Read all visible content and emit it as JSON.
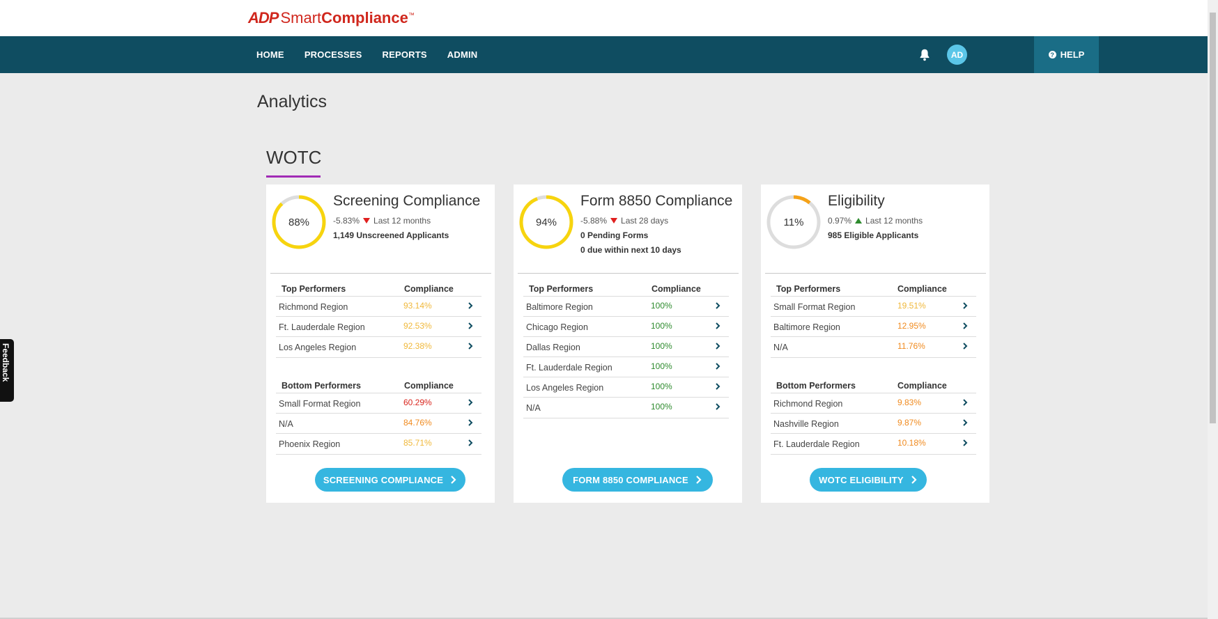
{
  "header": {
    "logo_mark": "ADP",
    "logo_text_1": "Smart",
    "logo_text_2": "Compliance",
    "logo_tm": "™"
  },
  "nav": {
    "items": [
      "HOME",
      "PROCESSES",
      "REPORTS",
      "ADMIN"
    ],
    "avatar_initials": "AD",
    "help_label": "HELP",
    "help_icon": "?"
  },
  "page": {
    "title": "Analytics",
    "section": "WOTC"
  },
  "colors": {
    "nav_bg": "#0f4d61",
    "accent": "#35b6e0",
    "section_underline": "#a12bb5",
    "gauge_yellow": "#f7d40e",
    "gauge_orange": "#f5a218",
    "gauge_track": "#dddddd",
    "value_yellow": "#f0b83a",
    "value_orange": "#f08a1e",
    "value_red": "#d9251d",
    "value_green": "#2e8b2e"
  },
  "cards": [
    {
      "title": "Screening Compliance",
      "gauge_label": "88%",
      "gauge_value": 0.88,
      "gauge_color": "#f7d40e",
      "delta": "-5.83%",
      "delta_direction": "down",
      "period": "Last 12 months",
      "line1": "1,149 Unscreened Applicants",
      "line2": "",
      "top_header": "Top Performers",
      "compliance_header": "Compliance",
      "top": [
        {
          "name": "Richmond Region",
          "value": "93.14%",
          "color": "#f0b83a"
        },
        {
          "name": "Ft. Lauderdale Region",
          "value": "92.53%",
          "color": "#f0b83a"
        },
        {
          "name": "Los Angeles Region",
          "value": "92.38%",
          "color": "#f0b83a"
        }
      ],
      "bottom_header": "Bottom Performers",
      "bottom": [
        {
          "name": "Small Format Region",
          "value": "60.29%",
          "color": "#d9251d"
        },
        {
          "name": "N/A",
          "value": "84.76%",
          "color": "#f08a1e"
        },
        {
          "name": "Phoenix Region",
          "value": "85.71%",
          "color": "#f0b83a"
        }
      ],
      "button": "SCREENING COMPLIANCE"
    },
    {
      "title": "Form 8850 Compliance",
      "gauge_label": "94%",
      "gauge_value": 0.94,
      "gauge_color": "#f7d40e",
      "delta": "-5.88%",
      "delta_direction": "down",
      "period": "Last 28 days",
      "line1": "0 Pending Forms",
      "line2": "0 due within next 10 days",
      "top_header": "Top Performers",
      "compliance_header": "Compliance",
      "top": [
        {
          "name": "Baltimore Region",
          "value": "100%",
          "color": "#2e8b2e"
        },
        {
          "name": "Chicago Region",
          "value": "100%",
          "color": "#2e8b2e"
        },
        {
          "name": "Dallas Region",
          "value": "100%",
          "color": "#2e8b2e"
        },
        {
          "name": "Ft. Lauderdale Region",
          "value": "100%",
          "color": "#2e8b2e"
        },
        {
          "name": "Los Angeles Region",
          "value": "100%",
          "color": "#2e8b2e"
        },
        {
          "name": "N/A",
          "value": "100%",
          "color": "#2e8b2e"
        }
      ],
      "bottom_header": "",
      "bottom": [],
      "button": "FORM 8850 COMPLIANCE"
    },
    {
      "title": "Eligibility",
      "gauge_label": "11%",
      "gauge_value": 0.11,
      "gauge_color": "#f5a218",
      "delta": "0.97%",
      "delta_direction": "up",
      "period": "Last 12 months",
      "line1": "985 Eligible Applicants",
      "line2": "",
      "top_header": "Top Performers",
      "compliance_header": "Compliance",
      "top": [
        {
          "name": "Small Format Region",
          "value": "19.51%",
          "color": "#f0b83a"
        },
        {
          "name": "Baltimore Region",
          "value": "12.95%",
          "color": "#f08a1e"
        },
        {
          "name": "N/A",
          "value": "11.76%",
          "color": "#f08a1e"
        }
      ],
      "bottom_header": "Bottom Performers",
      "bottom": [
        {
          "name": "Richmond Region",
          "value": "9.83%",
          "color": "#f08a1e"
        },
        {
          "name": "Nashville Region",
          "value": "9.87%",
          "color": "#f08a1e"
        },
        {
          "name": "Ft. Lauderdale Region",
          "value": "10.18%",
          "color": "#f08a1e"
        }
      ],
      "button": "WOTC ELIGIBILITY"
    }
  ],
  "feedback_label": "Feedback"
}
